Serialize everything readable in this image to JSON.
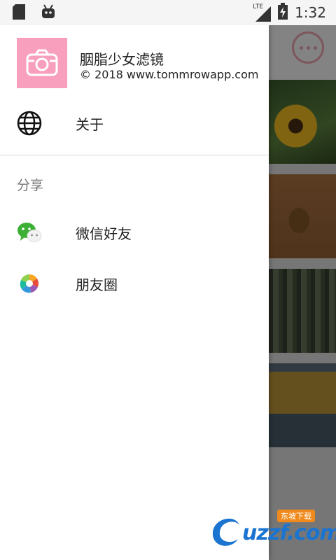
{
  "status_bar": {
    "network": "LTE",
    "time": "1:32"
  },
  "drawer": {
    "app_name": "胭脂少女滤镜",
    "copyright": "© 2018 www.tommrowapp.com",
    "about_label": "关于",
    "share_section_title": "分享",
    "share_items": [
      {
        "label": "微信好友",
        "icon": "wechat-icon"
      },
      {
        "label": "朋友圈",
        "icon": "moments-icon"
      }
    ]
  },
  "watermark": {
    "text": "uzzf.com",
    "tag": "东坡下载"
  },
  "colors": {
    "app_icon_bg": "#f89fbd",
    "more_button": "#c1868d",
    "watermark_blue": "#1a74d0"
  }
}
